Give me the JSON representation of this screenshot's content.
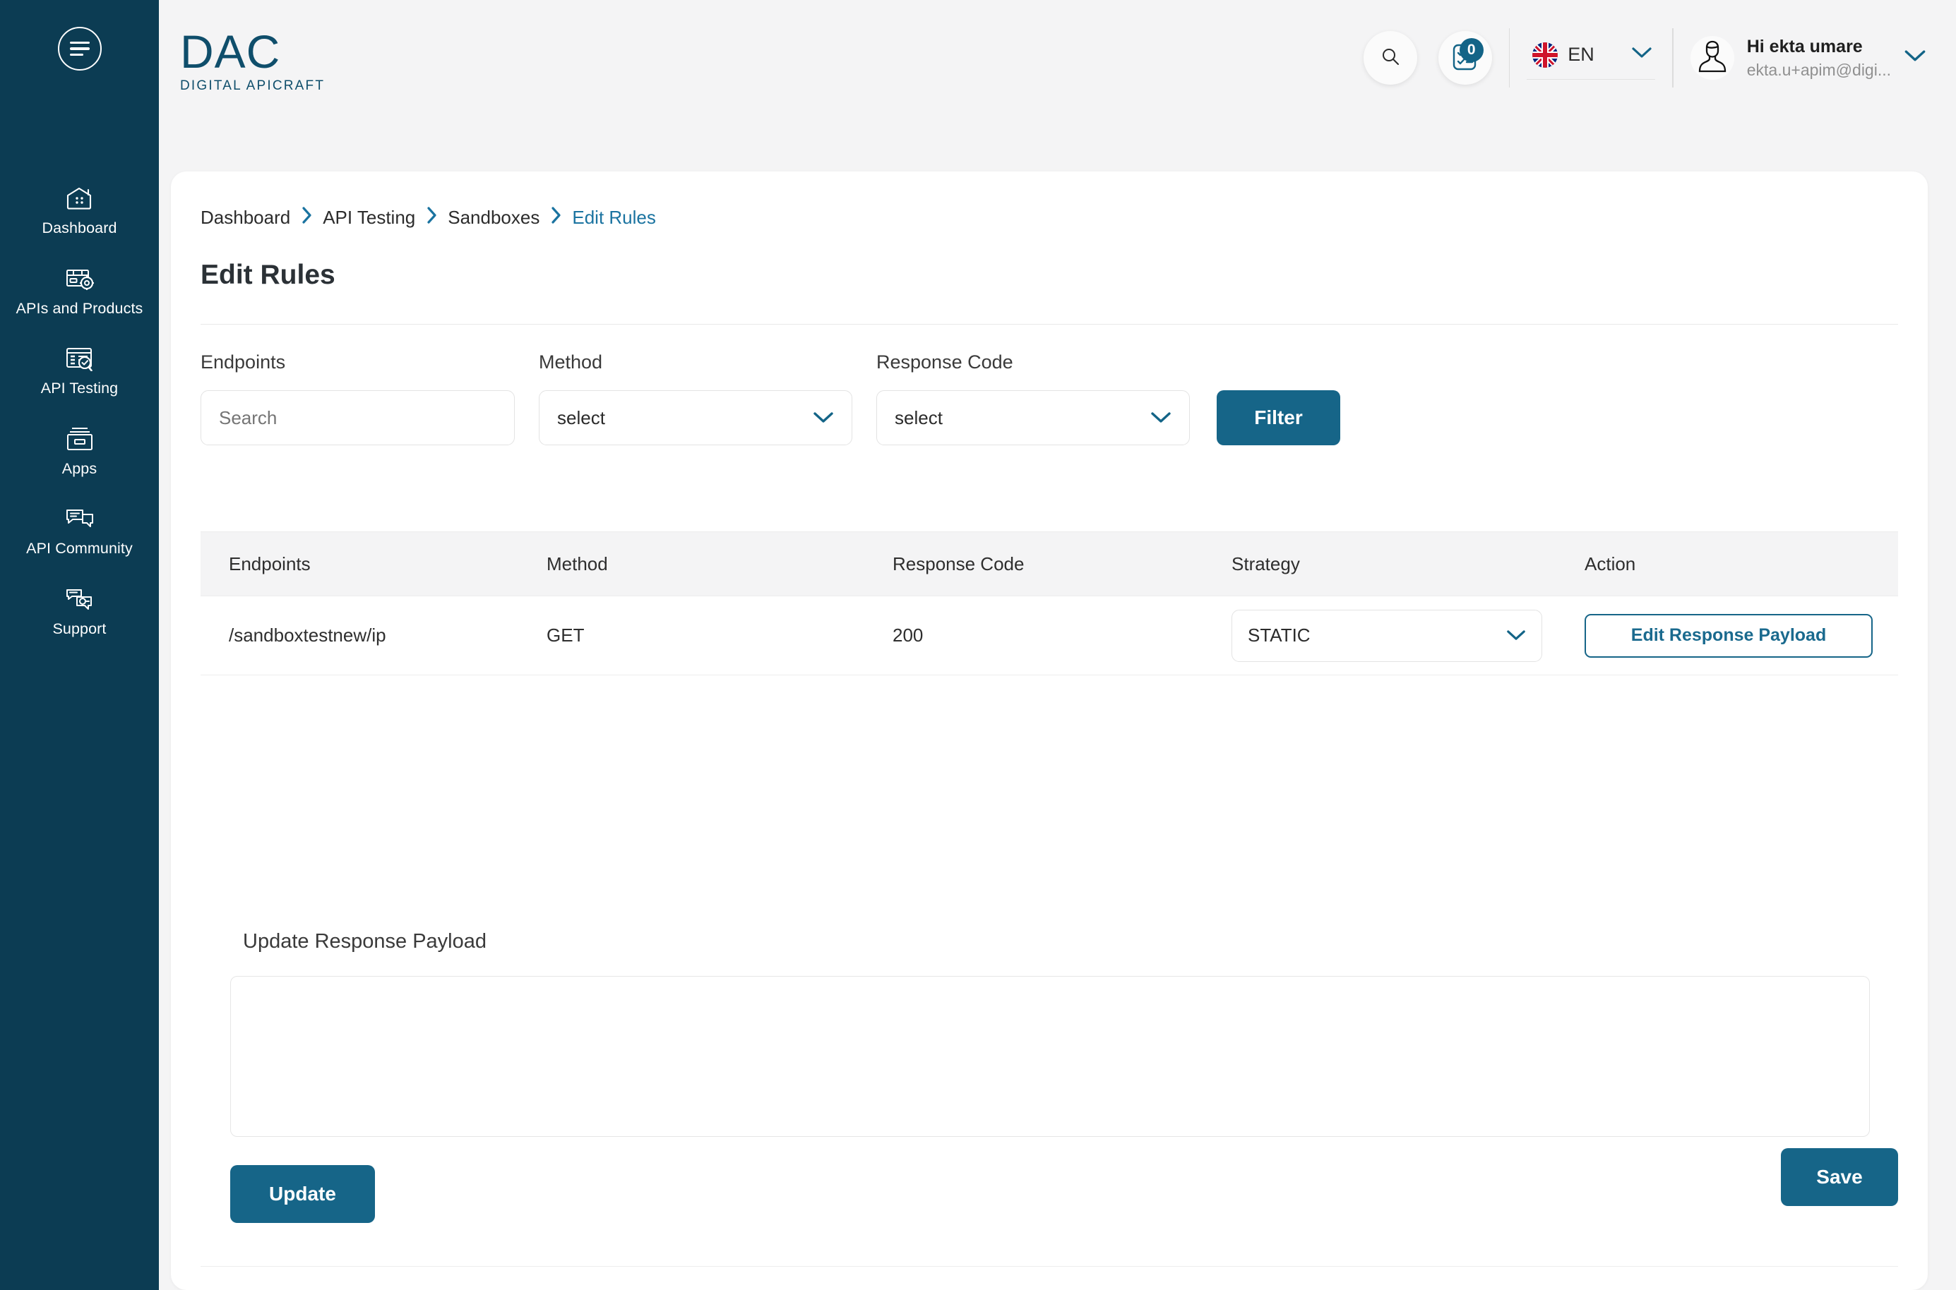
{
  "theme": {
    "sidebar_bg": "#0c3c53",
    "accent": "#166588",
    "link": "#1a73a0",
    "page_bg": "#f4f4f5",
    "card_bg": "#ffffff"
  },
  "sidebar": {
    "menu_icon": "hamburger-icon",
    "items": [
      {
        "label": "Dashboard",
        "icon": "dashboard-icon"
      },
      {
        "label": "APIs and Products",
        "icon": "apis-products-icon"
      },
      {
        "label": "API Testing",
        "icon": "api-testing-icon"
      },
      {
        "label": "Apps",
        "icon": "apps-icon"
      },
      {
        "label": "API Community",
        "icon": "api-community-icon"
      },
      {
        "label": "Support",
        "icon": "support-icon"
      }
    ]
  },
  "header": {
    "logo_text": "DAC",
    "logo_tagline": "DIGITAL APICRAFT",
    "search_icon": "search-icon",
    "notifications": {
      "icon": "tasks-checklist-icon",
      "count": "0"
    },
    "language": {
      "code": "EN",
      "flag": "uk-flag-icon",
      "chevron": "chevron-down-icon"
    },
    "user": {
      "greeting": "Hi ekta umare",
      "email": "ekta.u+apim@digi...",
      "avatar": "user-avatar-icon",
      "chevron": "chevron-down-icon"
    }
  },
  "breadcrumb": [
    {
      "label": "Dashboard",
      "active": false
    },
    {
      "label": "API Testing",
      "active": false
    },
    {
      "label": "Sandboxes",
      "active": false
    },
    {
      "label": "Edit Rules",
      "active": true
    }
  ],
  "page": {
    "title": "Edit Rules"
  },
  "filters": {
    "endpoints": {
      "label": "Endpoints",
      "placeholder": "Search",
      "value": ""
    },
    "method": {
      "label": "Method",
      "value": "select"
    },
    "response_code": {
      "label": "Response Code",
      "value": "select"
    },
    "filter_button": "Filter"
  },
  "table": {
    "columns": [
      "Endpoints",
      "Method",
      "Response Code",
      "Strategy",
      "Action"
    ],
    "rows": [
      {
        "endpoint": "/sandboxtestnew/ip",
        "method": "GET",
        "response_code": "200",
        "strategy": "STATIC",
        "action_label": "Edit Response Payload"
      }
    ]
  },
  "payload_panel": {
    "label": "Update Response Payload",
    "textarea_value": "",
    "textarea_placeholder": "",
    "update_button": "Update"
  },
  "footer": {
    "save_button": "Save"
  }
}
